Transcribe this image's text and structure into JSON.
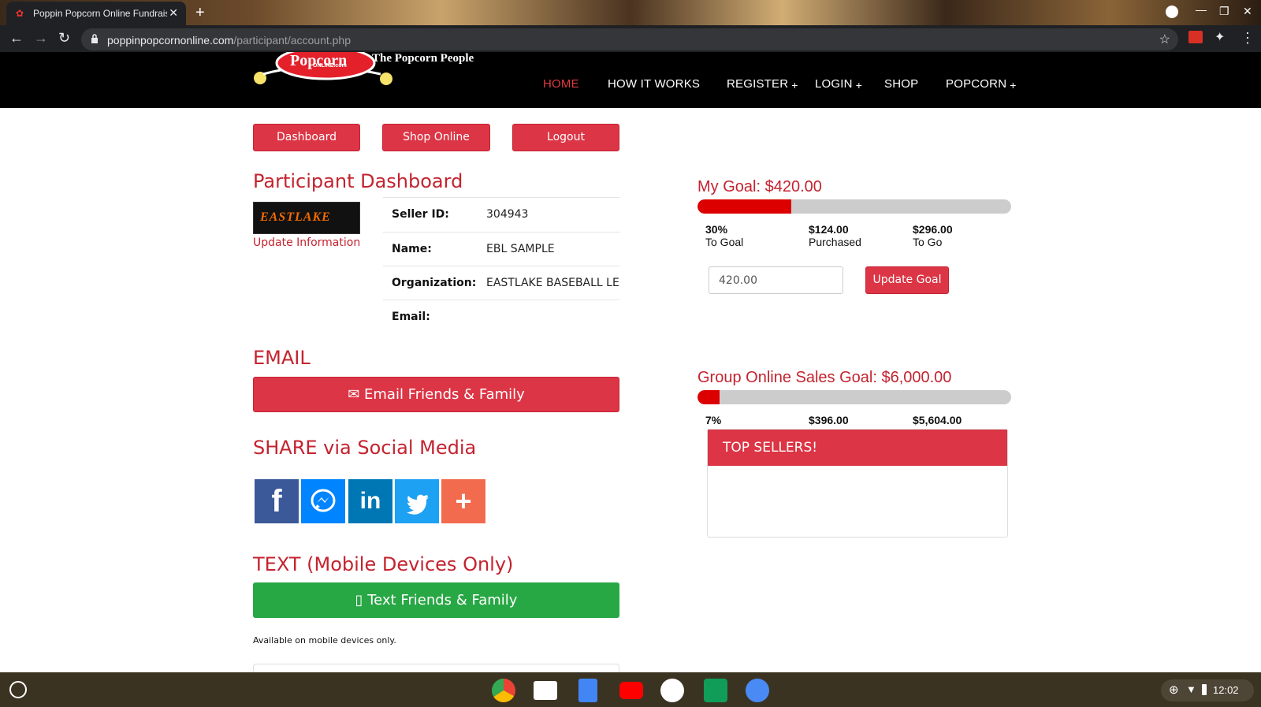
{
  "browser": {
    "tab_title": "Poppin Popcorn Online Fundraisi",
    "url_host": "poppinpopcornonline.com",
    "url_path": "/participant/account.php"
  },
  "site": {
    "tagline": "The Popcorn People",
    "logo_text": "Popcorn",
    "logo_sub": "ONLINE.com",
    "nav": {
      "home": "HOME",
      "how": "HOW IT WORKS",
      "register": "REGISTER",
      "login": "LOGIN",
      "shop": "SHOP",
      "popcorn": "POPCORN",
      "plus": "+"
    }
  },
  "actions": {
    "dashboard": "Dashboard",
    "shop_online": "Shop Online",
    "logout": "Logout"
  },
  "dashboard": {
    "title": "Participant Dashboard",
    "org_logo_text": "EASTLAKE",
    "update_info": "Update Information",
    "rows": [
      {
        "label": "Seller ID:",
        "value": "304943"
      },
      {
        "label": "Name:",
        "value": "EBL SAMPLE"
      },
      {
        "label": "Organization:",
        "value": "EASTLAKE BASEBALL LE"
      },
      {
        "label": "Email:",
        "value": ""
      }
    ]
  },
  "email": {
    "heading": "EMAIL",
    "button": "Email Friends & Family"
  },
  "social": {
    "heading": "SHARE via Social Media",
    "colors": {
      "facebook": "#3b5998",
      "messenger": "#0084ff",
      "linkedin": "#0077b5",
      "twitter": "#1da1f2",
      "more": "#f26b4f"
    }
  },
  "text": {
    "heading": "TEXT (Mobile Devices Only)",
    "button": "Text Friends & Family",
    "note": "Available on mobile devices only."
  },
  "my_goal": {
    "title": "My Goal: $420.00",
    "progress_fraction": 0.3,
    "pct": "30%",
    "pct_label": "To Goal",
    "purchased": "$124.00",
    "purchased_label": "Purchased",
    "to_go": "$296.00",
    "to_go_label": "To Go",
    "input_value": "420.00",
    "update_button": "Update Goal"
  },
  "group_goal": {
    "title": "Group Online Sales Goal: $6,000.00",
    "progress_fraction": 0.07,
    "pct": "7%",
    "purchased": "$396.00",
    "to_go": "$5,604.00"
  },
  "top_sellers": {
    "heading": "TOP SELLERS!"
  },
  "shelf": {
    "time": "12:02"
  }
}
